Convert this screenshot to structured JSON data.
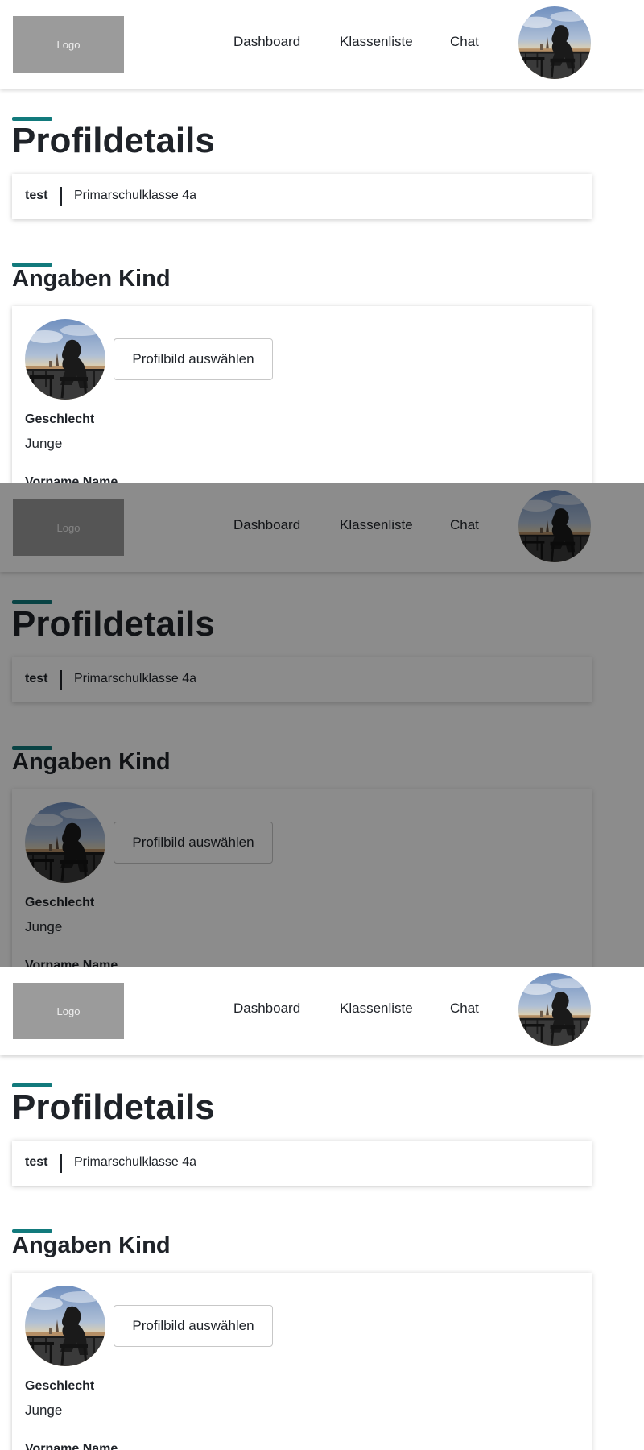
{
  "header": {
    "logo_label": "Logo",
    "nav": {
      "dashboard": "Dashboard",
      "klassenliste": "Klassenliste",
      "chat": "Chat"
    }
  },
  "profile": {
    "page_title": "Profildetails",
    "user_name": "test",
    "class_name": "Primarschulklasse 4a"
  },
  "child": {
    "section_title": "Angaben Kind",
    "pick_picture_button": "Profilbild auswählen",
    "gender_label": "Geschlecht",
    "gender_value": "Junge",
    "name_label": "Vorname Name"
  },
  "colors": {
    "accent": "#127a7c",
    "logo_bg": "#9b9b9b",
    "text": "#1f2329",
    "overlay": "rgba(0,0,0,0.45)"
  },
  "icons": {
    "avatar": "profile-photo"
  }
}
